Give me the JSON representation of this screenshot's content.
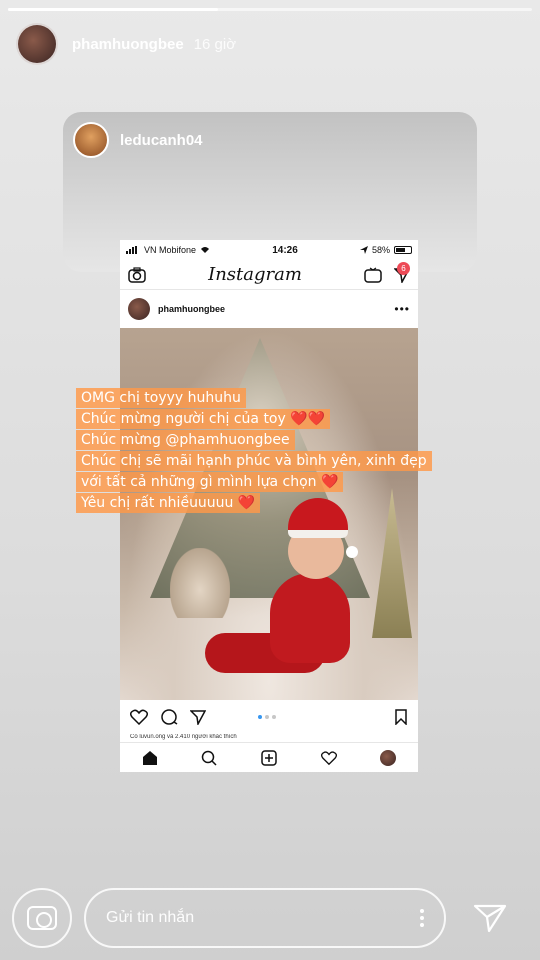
{
  "story": {
    "username": "phamhuongbee",
    "time": "16 giờ"
  },
  "repost": {
    "username": "leducanh04"
  },
  "screenshot": {
    "status": {
      "carrier": "VN Mobifone",
      "time": "14:26",
      "battery": "58%"
    },
    "app_title": "Instagram",
    "notification_count": "6",
    "post_username": "phamhuongbee",
    "likes_text": "Có luvun.ong và 2.410 người khác thích"
  },
  "caption": {
    "lines": [
      "OMG chị toyyy huhuhu",
      "Chúc mừng người chị của toy ❤️❤️",
      "Chúc mừng @phamhuongbee",
      "Chúc chị sẽ mãi hạnh phúc và bình yên, xinh đẹp",
      "với tất cả những gì mình lựa chọn ❤️",
      "Yêu chị rất nhiềuuuuu ❤️"
    ]
  },
  "reply": {
    "placeholder": "Gửi tin nhắn"
  },
  "icons": {
    "camera": "camera-icon",
    "send": "send-icon",
    "more": "more-icon"
  }
}
